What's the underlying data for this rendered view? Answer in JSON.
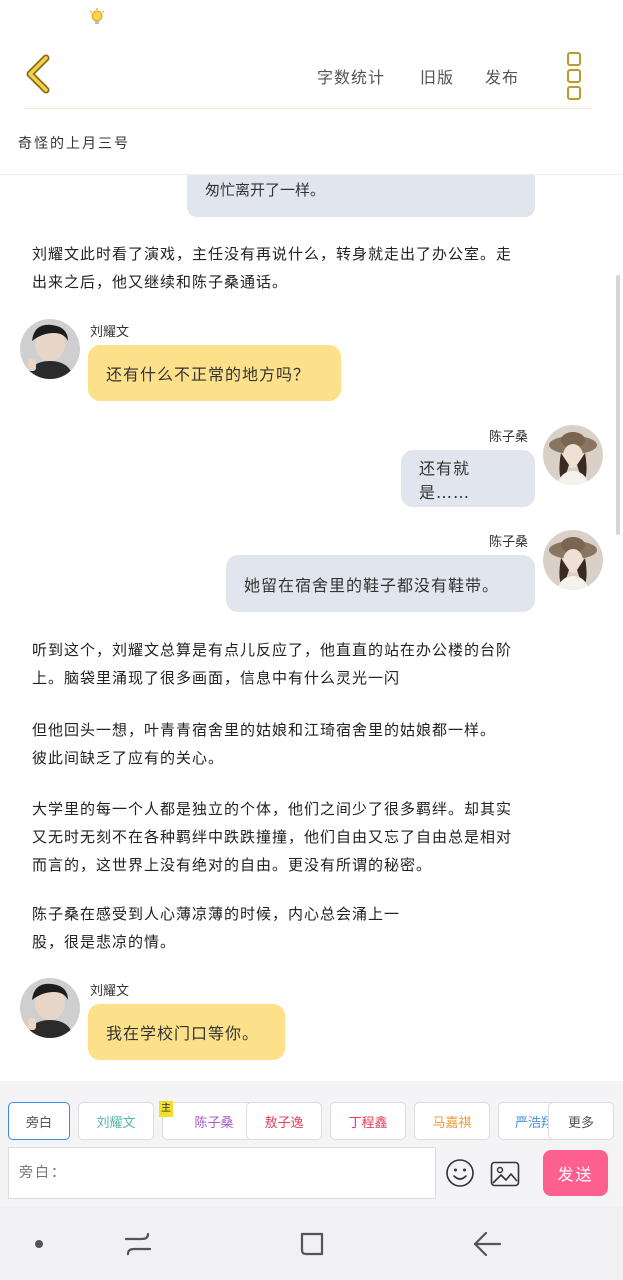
{
  "header": {
    "nav": [
      "字数统计",
      "旧版",
      "发布"
    ],
    "doc_title": "奇怪的上月三号"
  },
  "messages": [
    {
      "type": "bubble",
      "side": "right",
      "text": "匆忙离开了一样。"
    },
    {
      "type": "narration",
      "lines": [
        "刘耀文此时看了演戏，主任没有再说什么，转身就走出了办公室。走",
        "出来之后，他又继续和陈子桑通话。"
      ]
    },
    {
      "type": "chat",
      "speaker": "刘耀文",
      "text": "还有什么不正常的地方吗？"
    },
    {
      "type": "chat",
      "speaker": "陈子桑",
      "text": "还有就是……"
    },
    {
      "type": "chat",
      "speaker": "陈子桑",
      "text": "她留在宿舍里的鞋子都没有鞋带。"
    },
    {
      "type": "narration",
      "lines": [
        "听到这个，刘耀文总算是有点儿反应了，他直直的站在办公楼的台阶",
        "上。脑袋里涌现了很多画面，信息中有什么灵光一闪"
      ]
    },
    {
      "type": "narration",
      "lines": [
        "但他回头一想，叶青青宿舍里的姑娘和江琦宿舍里的姑娘都一样。",
        "彼此间缺乏了应有的关心。"
      ]
    },
    {
      "type": "narration",
      "lines": [
        "大学里的每一个人都是独立的个体，他们之间少了很多羁绊。却其实",
        "又无时无刻不在各种羁绊中跌跌撞撞，他们自由又忘了自由总是相对",
        "而言的，这世界上没有绝对的自由。更没有所谓的秘密。"
      ]
    },
    {
      "type": "narration",
      "lines": [
        "陈子桑在感受到人心薄凉薄的时候，内心总会涌上一",
        "股，很是悲凉的情。"
      ]
    },
    {
      "type": "chat",
      "speaker": "刘耀文",
      "text": "我在学校门口等你。"
    }
  ],
  "roles": {
    "items": [
      {
        "label": "旁白",
        "color": "#555555"
      },
      {
        "label": "刘耀文",
        "color": "#4fb8b0"
      },
      {
        "label": "陈子桑",
        "color": "#a85bc9"
      },
      {
        "label": "敖子逸",
        "color": "#e0405a"
      },
      {
        "label": "丁程鑫",
        "color": "#e0405a"
      },
      {
        "label": "马嘉祺",
        "color": "#ec9a3c"
      },
      {
        "label": "严浩翔",
        "color": "#4a8fd8"
      }
    ],
    "main_tag": "主",
    "more": "更多"
  },
  "compose": {
    "placeholder": "旁白：",
    "send": "发送",
    "emoji_icon": "smiley-icon",
    "image_icon": "image-icon"
  }
}
